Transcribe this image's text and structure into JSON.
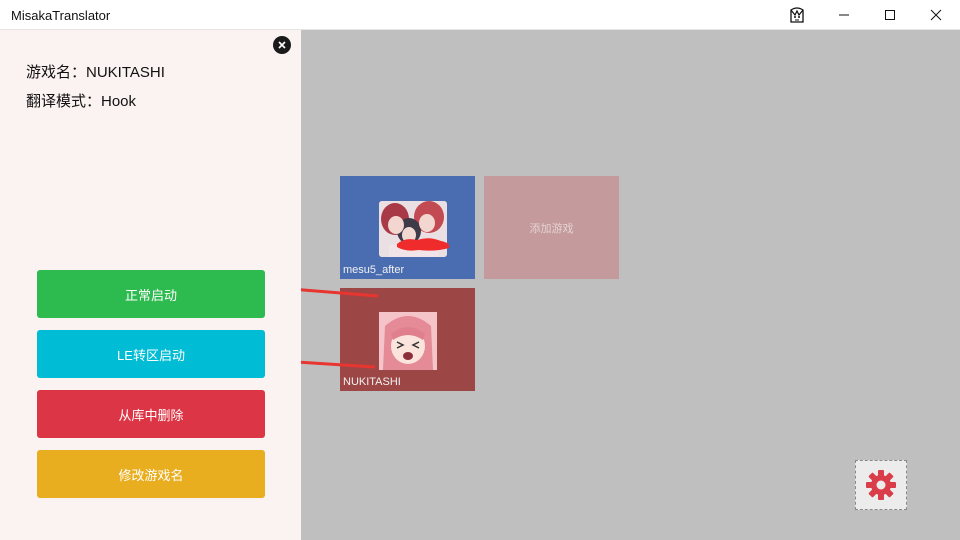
{
  "window": {
    "title": "MisakaTranslator",
    "controls": {
      "minimize": "minimize",
      "maximize": "maximize",
      "close": "close"
    }
  },
  "panel": {
    "game_name_line": "游戏名：NUKITASHI",
    "mode_line": "翻译模式：Hook",
    "buttons": {
      "normal_start": "正常启动",
      "le_start": "LE转区启动",
      "delete": "从库中删除",
      "rename": "修改游戏名"
    }
  },
  "games": [
    {
      "name": "mesu5_after",
      "color": "#4a6cb0"
    },
    {
      "name": "NUKITASHI",
      "color": "#9c4646"
    }
  ],
  "add_game": {
    "label": "添加游戏",
    "color": "#c49a9c"
  },
  "colors": {
    "green": "#2dba4e",
    "cyan": "#00bcd4",
    "red": "#dc3545",
    "amber": "#e9ae1f",
    "gear": "#d93d49"
  }
}
